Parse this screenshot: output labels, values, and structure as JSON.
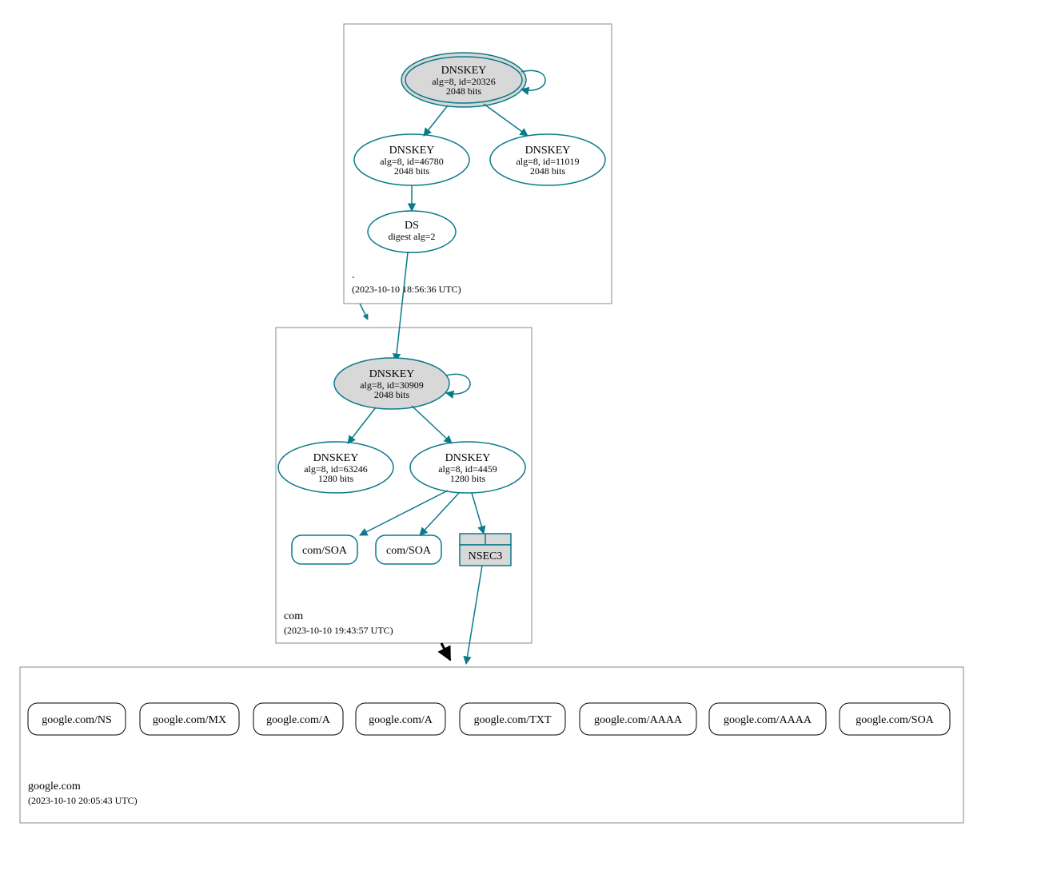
{
  "zones": {
    "root": {
      "name": ".",
      "timestamp": "(2023-10-10 18:56:36 UTC)"
    },
    "com": {
      "name": "com",
      "timestamp": "(2023-10-10 19:43:57 UTC)"
    },
    "google": {
      "name": "google.com",
      "timestamp": "(2023-10-10 20:05:43 UTC)"
    }
  },
  "nodes": {
    "root_ksk": {
      "title": "DNSKEY",
      "line1": "alg=8, id=20326",
      "line2": "2048 bits"
    },
    "root_zsk1": {
      "title": "DNSKEY",
      "line1": "alg=8, id=46780",
      "line2": "2048 bits"
    },
    "root_zsk2": {
      "title": "DNSKEY",
      "line1": "alg=8, id=11019",
      "line2": "2048 bits"
    },
    "root_ds": {
      "title": "DS",
      "line1": "digest alg=2"
    },
    "com_ksk": {
      "title": "DNSKEY",
      "line1": "alg=8, id=30909",
      "line2": "2048 bits"
    },
    "com_zsk1": {
      "title": "DNSKEY",
      "line1": "alg=8, id=63246",
      "line2": "1280 bits"
    },
    "com_zsk2": {
      "title": "DNSKEY",
      "line1": "alg=8, id=4459",
      "line2": "1280 bits"
    },
    "com_soa1": {
      "label": "com/SOA"
    },
    "com_soa2": {
      "label": "com/SOA"
    },
    "nsec3": {
      "label": "NSEC3"
    },
    "g_ns": {
      "label": "google.com/NS"
    },
    "g_mx": {
      "label": "google.com/MX"
    },
    "g_a1": {
      "label": "google.com/A"
    },
    "g_a2": {
      "label": "google.com/A"
    },
    "g_txt": {
      "label": "google.com/TXT"
    },
    "g_aaaa1": {
      "label": "google.com/AAAA"
    },
    "g_aaaa2": {
      "label": "google.com/AAAA"
    },
    "g_soa": {
      "label": "google.com/SOA"
    }
  }
}
